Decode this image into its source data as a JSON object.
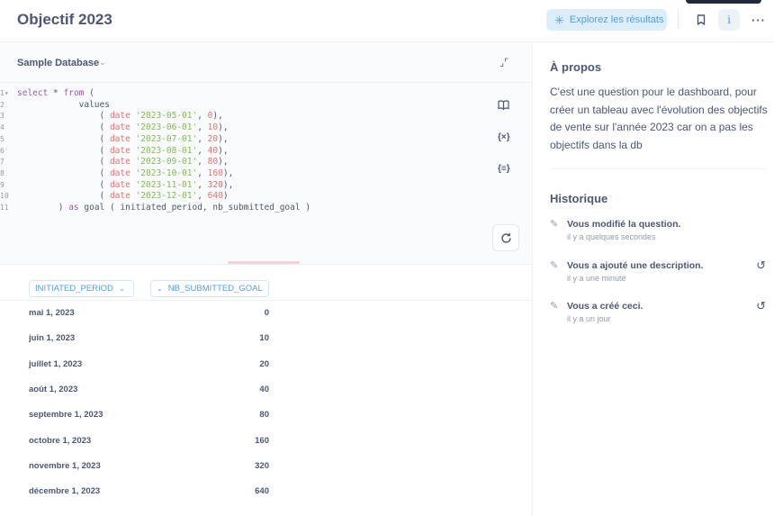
{
  "header": {
    "title": "Objectif 2023",
    "explore_label": "Explorez les résultats",
    "icons": {
      "explore": "sparkle-icon",
      "bookmark": "bookmark-icon",
      "info": "info-icon",
      "more": "more-icon"
    },
    "accent_color": "#509ee3"
  },
  "editor": {
    "database": "Sample Database",
    "line_numbers": [
      "1",
      "2",
      "3",
      "4",
      "5",
      "6",
      "7",
      "8",
      "9",
      "10",
      "11"
    ],
    "sql_lines": [
      [
        {
          "t": "kw",
          "v": "select"
        },
        {
          "t": "",
          "v": " * "
        },
        {
          "t": "kw",
          "v": "from"
        },
        {
          "t": "",
          "v": " ("
        }
      ],
      [
        {
          "t": "",
          "v": "            values"
        }
      ],
      [
        {
          "t": "",
          "v": "                ( "
        },
        {
          "t": "fn",
          "v": "date"
        },
        {
          "t": "",
          "v": " "
        },
        {
          "t": "str",
          "v": "'2023-05-01'"
        },
        {
          "t": "",
          "v": ", "
        },
        {
          "t": "fn",
          "v": "0"
        },
        {
          "t": "",
          "v": "),"
        }
      ],
      [
        {
          "t": "",
          "v": "                ( "
        },
        {
          "t": "fn",
          "v": "date"
        },
        {
          "t": "",
          "v": " "
        },
        {
          "t": "str",
          "v": "'2023-06-01'"
        },
        {
          "t": "",
          "v": ", "
        },
        {
          "t": "fn",
          "v": "10"
        },
        {
          "t": "",
          "v": "),"
        }
      ],
      [
        {
          "t": "",
          "v": "                ( "
        },
        {
          "t": "fn",
          "v": "date"
        },
        {
          "t": "",
          "v": " "
        },
        {
          "t": "str",
          "v": "'2023-07-01'"
        },
        {
          "t": "",
          "v": ", "
        },
        {
          "t": "fn",
          "v": "20"
        },
        {
          "t": "",
          "v": "),"
        }
      ],
      [
        {
          "t": "",
          "v": "                ( "
        },
        {
          "t": "fn",
          "v": "date"
        },
        {
          "t": "",
          "v": " "
        },
        {
          "t": "str",
          "v": "'2023-08-01'"
        },
        {
          "t": "",
          "v": ", "
        },
        {
          "t": "fn",
          "v": "40"
        },
        {
          "t": "",
          "v": "),"
        }
      ],
      [
        {
          "t": "",
          "v": "                ( "
        },
        {
          "t": "fn",
          "v": "date"
        },
        {
          "t": "",
          "v": " "
        },
        {
          "t": "str",
          "v": "'2023-09-01'"
        },
        {
          "t": "",
          "v": ", "
        },
        {
          "t": "fn",
          "v": "80"
        },
        {
          "t": "",
          "v": "),"
        }
      ],
      [
        {
          "t": "",
          "v": "                ( "
        },
        {
          "t": "fn",
          "v": "date"
        },
        {
          "t": "",
          "v": " "
        },
        {
          "t": "str",
          "v": "'2023-10-01'"
        },
        {
          "t": "",
          "v": ", "
        },
        {
          "t": "fn",
          "v": "160"
        },
        {
          "t": "",
          "v": "),"
        }
      ],
      [
        {
          "t": "",
          "v": "                ( "
        },
        {
          "t": "fn",
          "v": "date"
        },
        {
          "t": "",
          "v": " "
        },
        {
          "t": "str",
          "v": "'2023-11-01'"
        },
        {
          "t": "",
          "v": ", "
        },
        {
          "t": "fn",
          "v": "320"
        },
        {
          "t": "",
          "v": "),"
        }
      ],
      [
        {
          "t": "",
          "v": "                ( "
        },
        {
          "t": "fn",
          "v": "date"
        },
        {
          "t": "",
          "v": " "
        },
        {
          "t": "str",
          "v": "'2023-12-01'"
        },
        {
          "t": "",
          "v": ", "
        },
        {
          "t": "fn",
          "v": "640"
        },
        {
          "t": "",
          "v": ")"
        }
      ],
      [
        {
          "t": "",
          "v": "        ) "
        },
        {
          "t": "kw",
          "v": "as"
        },
        {
          "t": "",
          "v": " goal ( initiated_period, nb_submitted_goal )"
        }
      ]
    ],
    "side_icons": {
      "reference": "book-icon",
      "variables": "{×}",
      "snippets": "{≡}",
      "refresh": "refresh-icon"
    }
  },
  "results": {
    "columns": [
      "INITIATED_PERIOD",
      "NB_SUBMITTED_GOAL"
    ],
    "rows": [
      [
        "mai 1, 2023",
        "0"
      ],
      [
        "juin 1, 2023",
        "10"
      ],
      [
        "juillet 1, 2023",
        "20"
      ],
      [
        "août 1, 2023",
        "40"
      ],
      [
        "septembre 1, 2023",
        "80"
      ],
      [
        "octobre 1, 2023",
        "160"
      ],
      [
        "novembre 1, 2023",
        "320"
      ],
      [
        "décembre 1, 2023",
        "640"
      ]
    ]
  },
  "sidebar": {
    "about_title": "À propos",
    "about_text": "C'est une question pour le dashboard, pour créer un tableau avec l'évolution des objectifs de vente sur l'année 2023 car on a pas les objectifs dans la db",
    "history_title": "Historique",
    "history": [
      {
        "title": "Vous modifié la question.",
        "time": "il y a quelques secondes",
        "revert": false
      },
      {
        "title": "Vous a ajouté une description.",
        "time": "il y a une minute",
        "revert": true
      },
      {
        "title": "Vous a créé ceci.",
        "time": "il y a un jour",
        "revert": true
      }
    ]
  }
}
